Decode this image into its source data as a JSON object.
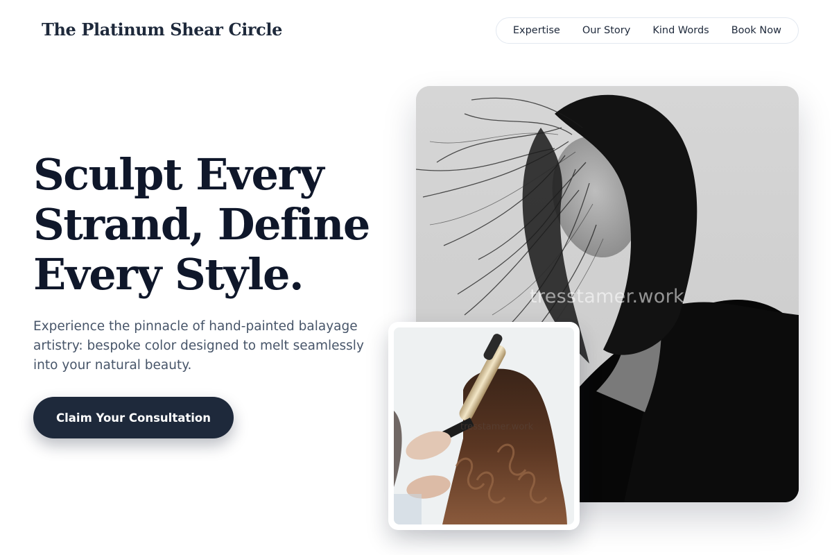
{
  "header": {
    "brand": "The Platinum Shear Circle",
    "nav": [
      {
        "label": "Expertise"
      },
      {
        "label": "Our Story"
      },
      {
        "label": "Kind Words"
      },
      {
        "label": "Book Now"
      }
    ]
  },
  "hero": {
    "headline": "Sculpt Every Strand, Define Every Style.",
    "subheadline": "Experience the pinnacle of hand-painted balayage artistry: bespoke color designed to melt seamlessly into your natural beauty.",
    "cta_label": "Claim Your Consultation"
  },
  "images": {
    "main_watermark": "tresstamer.work",
    "inset_watermark": "tresstamer.work"
  },
  "colors": {
    "primary": "#1e293b",
    "headline": "#0f172a",
    "body_text": "#475569",
    "nav_border": "#e2e8f0",
    "background": "#ffffff"
  }
}
